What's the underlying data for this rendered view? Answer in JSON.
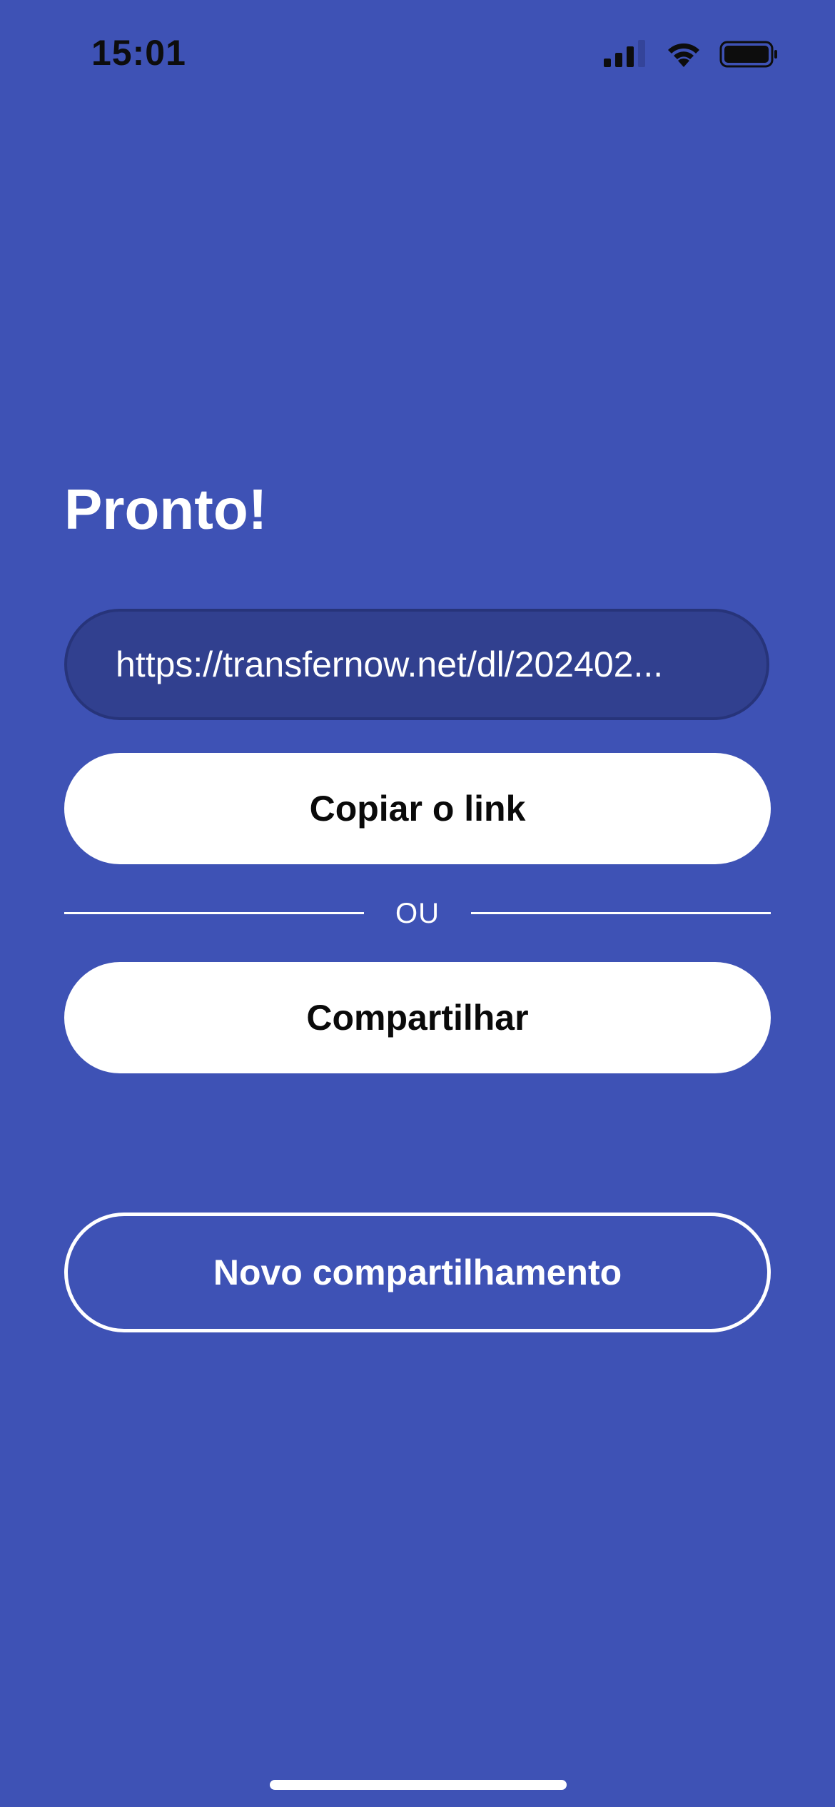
{
  "status_bar": {
    "time": "15:01",
    "icons": [
      "cellular-signal-icon",
      "wifi-icon",
      "battery-icon"
    ]
  },
  "screen": {
    "title": "Pronto!",
    "link_value": "https://transfernow.net/dl/202402...",
    "copy_button_label": "Copiar o link",
    "divider_label": "OU",
    "share_button_label": "Compartilhar",
    "new_share_button_label": "Novo compartilhamento"
  },
  "colors": {
    "background": "#3e52b5",
    "link_field_background": "#31408f",
    "button_background": "#ffffff",
    "button_text": "#0a0a0a"
  }
}
